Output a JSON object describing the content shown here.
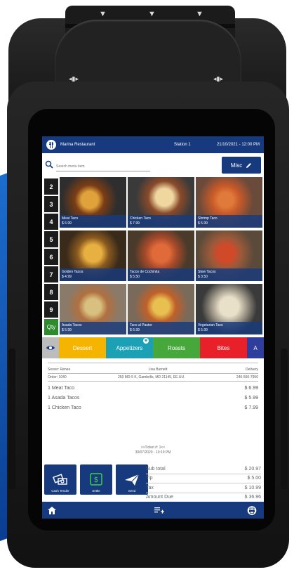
{
  "app": {
    "name": "Marina Restaurant",
    "station": "Station 1",
    "datetime": "21/10/2021 - 12:00 PM"
  },
  "search": {
    "placeholder": "Search menu item"
  },
  "misc_label": "Misc",
  "quantity_buttons": [
    "2",
    "3",
    "4",
    "5",
    "6",
    "7",
    "8",
    "9",
    "Qty"
  ],
  "menu_items": [
    {
      "name": "Meat Taco",
      "price": "$ 6.99"
    },
    {
      "name": "Chicken Taco",
      "price": "$ 7.99"
    },
    {
      "name": "Shrimp Taco",
      "price": "$ 5.99"
    },
    {
      "name": "Golden Tacos",
      "price": "$ 4.99"
    },
    {
      "name": "Tacos de Cochinita",
      "price": "$ 5.50"
    },
    {
      "name": "Stew Tacos",
      "price": "$ 3.50"
    },
    {
      "name": "Asada Tacos",
      "price": "$ 5.99"
    },
    {
      "name": "Taco al Pastor",
      "price": "$ 6.99"
    },
    {
      "name": "Vegetarian Taco",
      "price": "$ 5.99"
    }
  ],
  "categories": [
    {
      "label": "Dessert",
      "color": "#f5b400"
    },
    {
      "label": "Appetizers",
      "color": "#1ba0b6"
    },
    {
      "label": "Roasts",
      "color": "#46a83a"
    },
    {
      "label": "Bites",
      "color": "#e8202a"
    },
    {
      "label": "A",
      "color": "#2f3d9c"
    }
  ],
  "order": {
    "server": "Server: Renee",
    "customer": "Lisa Burnett",
    "type": "Delivery",
    "number": "Order: 1040",
    "address": "250 MD-5 K, Gambrills, MD 21145, EE.UU.",
    "phone": "240-550-7950",
    "items": [
      {
        "name": "1 Meat Taco",
        "price": "$ 6.99"
      },
      {
        "name": "1 Asada Tacos",
        "price": "$ 5.99"
      },
      {
        "name": "1 Chicken Taco",
        "price": "$ 7.99"
      }
    ],
    "ticket_label": ">>Ticket #: 1<<",
    "ticket_datetime": "30/07/2020 - 10:19 PM"
  },
  "actions": {
    "cash_tender": "Cash Tender",
    "settle": "Settle",
    "send": "Send"
  },
  "totals": {
    "subtotal_label": "Sub total",
    "subtotal": "$ 20.97",
    "tip_label": "Tip",
    "tip": "$ 5.00",
    "tax_label": "Tax",
    "tax": "$ 10.99",
    "amount_due_label": "Amount Due",
    "amount_due": "$ 36.96"
  },
  "colors": {
    "brand": "#173a7e",
    "qty_accent": "#2d8a2d"
  },
  "icons": [
    "search-icon",
    "pencil-icon",
    "eye-icon",
    "cash-icon",
    "money-icon",
    "send-icon",
    "home-icon",
    "add-list-icon",
    "printer-icon"
  ]
}
